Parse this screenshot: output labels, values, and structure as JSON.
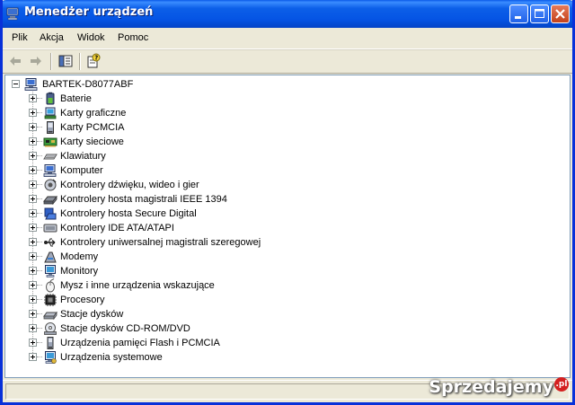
{
  "window": {
    "title": "Menedżer urządzeń"
  },
  "menu": [
    "Plik",
    "Akcja",
    "Widok",
    "Pomoc"
  ],
  "toolbar": {
    "icons": [
      "back-arrow-icon",
      "forward-arrow-icon",
      "show-hide-console-tree-icon",
      "properties-help-icon"
    ]
  },
  "tree": {
    "root": {
      "label": "BARTEK-D8077ABF",
      "icon": "computer-icon"
    },
    "children": [
      {
        "label": "Baterie",
        "icon": "battery-icon"
      },
      {
        "label": "Karty graficzne",
        "icon": "display-adapter-icon"
      },
      {
        "label": "Karty PCMCIA",
        "icon": "pcmcia-icon"
      },
      {
        "label": "Karty sieciowe",
        "icon": "network-card-icon"
      },
      {
        "label": "Klawiatury",
        "icon": "keyboard-icon"
      },
      {
        "label": "Komputer",
        "icon": "computer-icon"
      },
      {
        "label": "Kontrolery dźwięku, wideo i gier",
        "icon": "sound-icon"
      },
      {
        "label": "Kontrolery hosta magistrali IEEE 1394",
        "icon": "ieee1394-icon"
      },
      {
        "label": "Kontrolery hosta Secure Digital",
        "icon": "sd-host-icon"
      },
      {
        "label": "Kontrolery IDE ATA/ATAPI",
        "icon": "ide-controller-icon"
      },
      {
        "label": "Kontrolery uniwersalnej magistrali szeregowej",
        "icon": "usb-icon"
      },
      {
        "label": "Modemy",
        "icon": "modem-icon"
      },
      {
        "label": "Monitory",
        "icon": "monitor-icon"
      },
      {
        "label": "Mysz i inne urządzenia wskazujące",
        "icon": "mouse-icon"
      },
      {
        "label": "Procesory",
        "icon": "processor-icon"
      },
      {
        "label": "Stacje dysków",
        "icon": "disk-drive-icon"
      },
      {
        "label": "Stacje dysków CD-ROM/DVD",
        "icon": "cdrom-icon"
      },
      {
        "label": "Urządzenia pamięci Flash i PCMCIA",
        "icon": "flash-memory-icon"
      },
      {
        "label": "Urządzenia systemowe",
        "icon": "system-devices-icon"
      }
    ]
  },
  "watermark": {
    "text": "Sprzedajemy",
    "suffix": ".pl"
  },
  "colors": {
    "titlebar": "#0554e4",
    "window_bg": "#ece9d8",
    "close_button": "#c4411a"
  }
}
